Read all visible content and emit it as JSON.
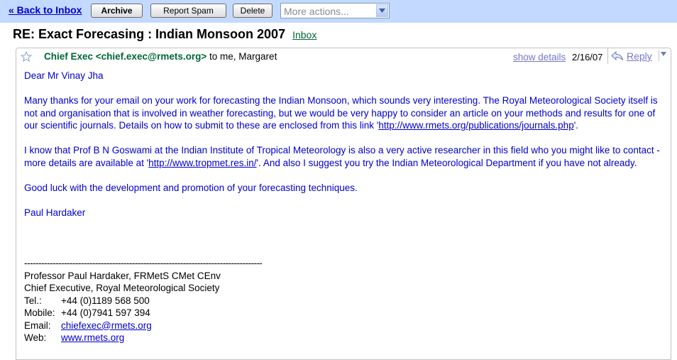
{
  "toolbar": {
    "back_link": "« Back to Inbox",
    "archive": "Archive",
    "report_spam": "Report Spam",
    "delete": "Delete",
    "more_actions": "More actions..."
  },
  "subject": "RE: Exact Forecasing : Indian Monsoon 2007",
  "label": "Inbox",
  "message": {
    "sender_name": "Chief Exec <chief.exec@rmets.org>",
    "recipients": " to me, Margaret",
    "show_details": "show details",
    "date": "2/16/07",
    "reply": "Reply",
    "greeting": "Dear Mr Vinay Jha",
    "para1_text": "Many thanks for your email on your work for forecasting the Indian Monsoon, which sounds very interesting.  The Royal Meteorological Society itself is not and organisation that is involved in weather forecasting, but we would be very happy to consider an article on your methods and results for one of our scientific journals.  Details on how to submit to these are enclosed from this link '",
    "para1_link": "http://www.rmets.org/publications/journals.php",
    "para1_end": "'.",
    "para2_text": "I know that Prof B N Goswami  at the Indian Institute of Tropical Meteorology is also a very active researcher in this field who you might like to contact - more details are available at '",
    "para2_link": "http://www.tropmet.res.in/",
    "para2_end": "'.  And also I suggest you try the Indian Meteorological Department if you have not already.",
    "para3": "Good luck with the development and promotion of your forecasting techniques.",
    "closing": "Paul Hardaker",
    "signature": {
      "divider": "------------------------------------------------------------------------------------",
      "line1": "Professor Paul Hardaker, FRMetS CMet CEnv",
      "line2": "Chief Executive,  Royal Meteorological Society",
      "tel_label": "Tel.:",
      "tel": "+44 (0)1189 568 500",
      "mobile_label": "Mobile:",
      "mobile": "+44 (0)7941 597 394",
      "email_label": "Email:",
      "email": "chiefexec@rmets.org",
      "web_label": "Web:",
      "web": "www.rmets.org"
    }
  },
  "colors": {
    "toolbar_bg": "#c3d9ff",
    "link": "#0000cc",
    "sender": "#006633",
    "body_text": "#0000cc"
  }
}
